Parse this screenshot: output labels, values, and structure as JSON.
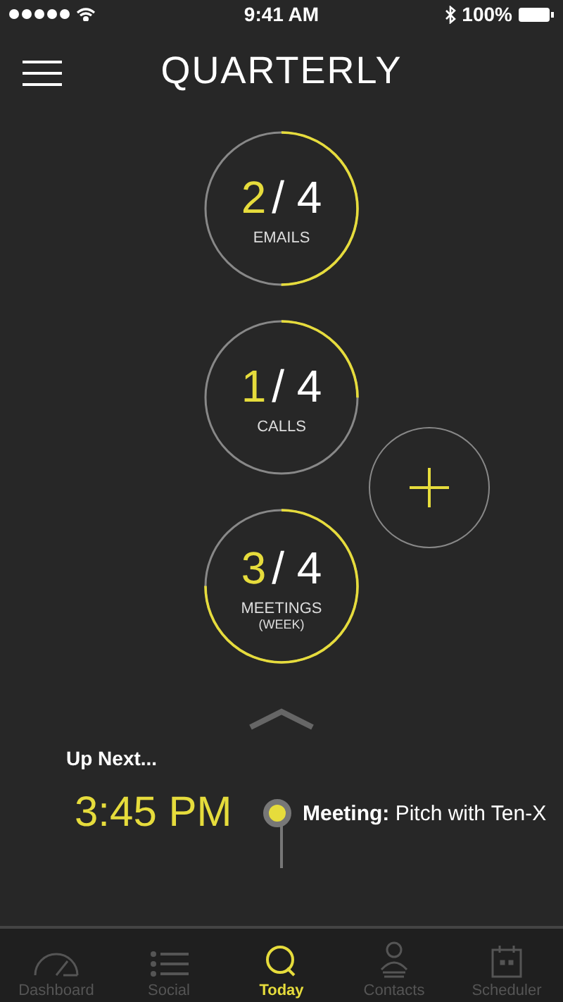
{
  "status_bar": {
    "time": "9:41 AM",
    "battery": "100%"
  },
  "header": {
    "title": "QUARTERLY"
  },
  "goals": [
    {
      "done": "2",
      "total": "/ 4",
      "label": "EMAILS"
    },
    {
      "done": "1",
      "total": "/ 4",
      "label": "CALLS"
    },
    {
      "done": "3",
      "total": "/ 4",
      "label": "MEETINGS",
      "sublabel": "(WEEK)"
    }
  ],
  "up_next": {
    "heading": "Up Next...",
    "time": "3:45 PM",
    "event": "**Meeting:** Pitch with Ten-X"
  },
  "tabs": [
    {
      "label": "Dashboard",
      "selected": false
    },
    {
      "label": "Social",
      "selected": false
    },
    {
      "label": "Today",
      "selected": true
    },
    {
      "label": "Contacts",
      "selected": false
    },
    {
      "label": "Scheduler",
      "selected": false
    }
  ]
}
